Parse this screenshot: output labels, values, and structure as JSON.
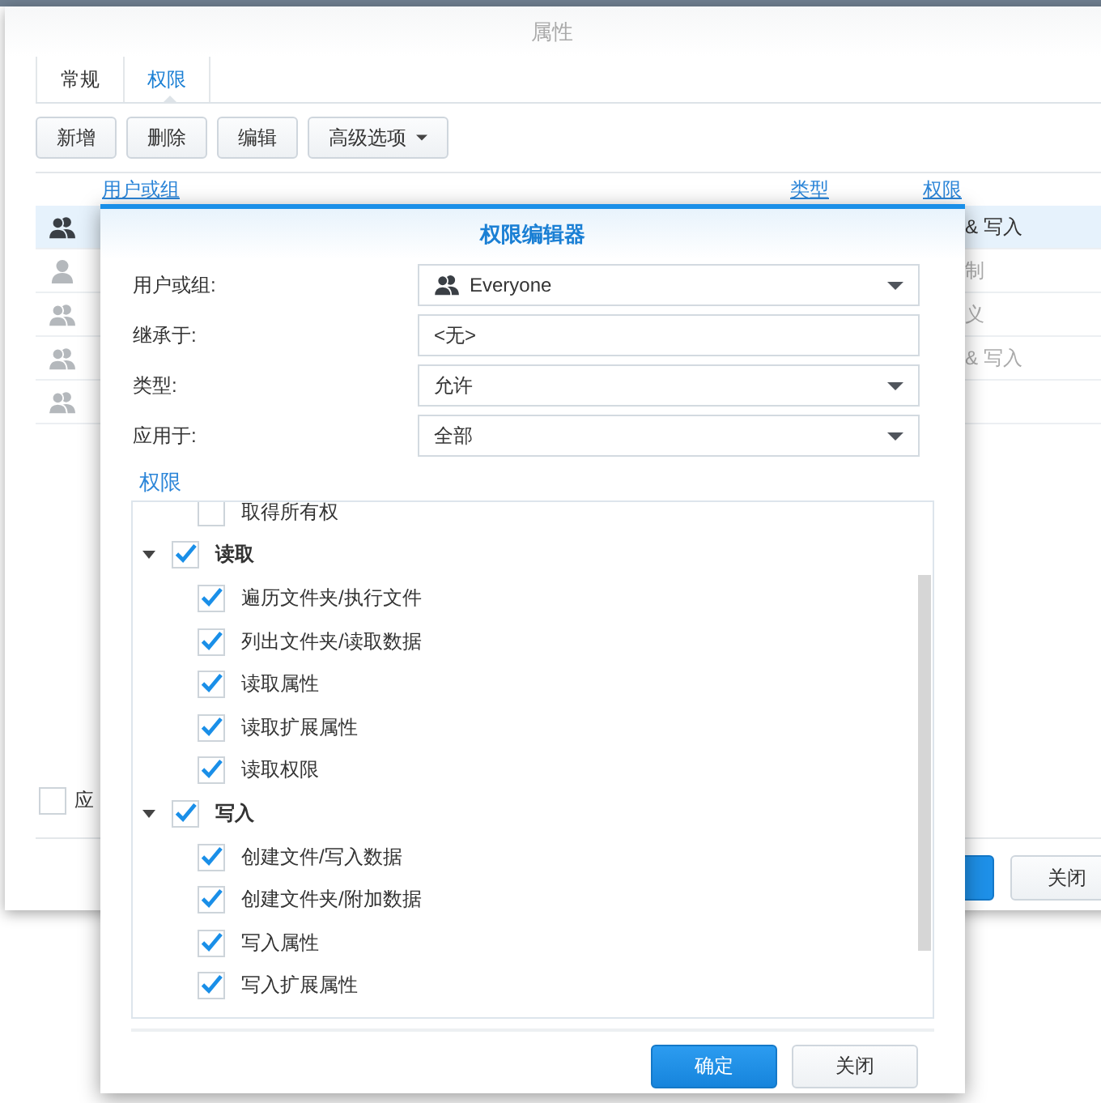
{
  "window": {
    "title": "属性"
  },
  "tabs": [
    {
      "label": "常规",
      "selected": false
    },
    {
      "label": "权限",
      "selected": true
    }
  ],
  "toolbar": [
    {
      "label": "新增",
      "kind": "button"
    },
    {
      "label": "删除",
      "kind": "button"
    },
    {
      "label": "编辑",
      "kind": "button"
    },
    {
      "label": "高级选项",
      "kind": "dropdown"
    }
  ],
  "table": {
    "columns": [
      "用户或组",
      "类型",
      "权限"
    ],
    "rows": [
      {
        "kind": "group",
        "permission": "& 写入",
        "selected": true,
        "disabled": false
      },
      {
        "kind": "user",
        "permission": "制",
        "selected": false,
        "disabled": true
      },
      {
        "kind": "group",
        "permission": "义",
        "selected": false,
        "disabled": true
      },
      {
        "kind": "group",
        "permission": "& 写入",
        "selected": false,
        "disabled": true
      },
      {
        "kind": "group",
        "selected": false,
        "disabled": true
      }
    ]
  },
  "apply_option": {
    "label": "应",
    "checked": false
  },
  "footer_buttons": [
    {
      "kind": "primary"
    },
    {
      "kind": "secondary",
      "label": "关闭"
    }
  ],
  "dialog": {
    "title": "权限编辑器",
    "fields": [
      {
        "label": "用户或组:",
        "value": "Everyone",
        "kind": "group_select"
      },
      {
        "label": "继承于:",
        "value": "<无>",
        "kind": "text"
      },
      {
        "label": "类型:",
        "value": "允许",
        "kind": "select"
      },
      {
        "label": "应用于:",
        "value": "全部",
        "kind": "select"
      }
    ],
    "section_title": "权限",
    "permissions": [
      {
        "kind": "leaf",
        "label": "取得所有权",
        "checked": false
      },
      {
        "kind": "group",
        "label": "读取",
        "checked": true,
        "expanded": true,
        "children": [
          {
            "label": "遍历文件夹/执行文件",
            "checked": true
          },
          {
            "label": "列出文件夹/读取数据",
            "checked": true
          },
          {
            "label": "读取属性",
            "checked": true
          },
          {
            "label": "读取扩展属性",
            "checked": true
          },
          {
            "label": "读取权限",
            "checked": true
          }
        ]
      },
      {
        "kind": "group",
        "label": "写入",
        "checked": true,
        "expanded": true,
        "children": [
          {
            "label": "创建文件/写入数据",
            "checked": true
          },
          {
            "label": "创建文件夹/附加数据",
            "checked": true
          },
          {
            "label": "写入属性",
            "checked": true
          },
          {
            "label": "写入扩展属性",
            "checked": true
          }
        ]
      }
    ],
    "buttons": [
      {
        "kind": "primary",
        "label": "确定"
      },
      {
        "kind": "secondary",
        "label": "关闭"
      }
    ]
  }
}
